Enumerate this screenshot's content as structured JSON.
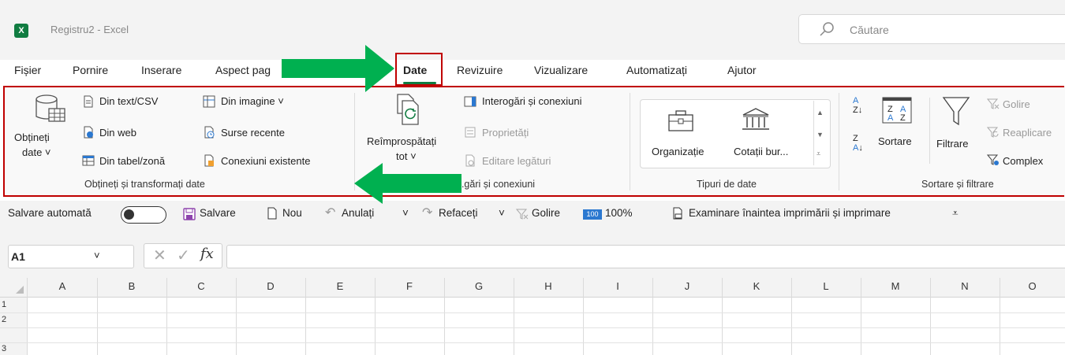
{
  "app": {
    "logo": "X",
    "title": "Registru2 - Excel"
  },
  "search": {
    "placeholder": "Căutare",
    "icon": "search-icon"
  },
  "menu": {
    "items": [
      "Fișier",
      "Pornire",
      "Inserare",
      "Aspect pag",
      "Date",
      "Revizuire",
      "Vizualizare",
      "Automatizați",
      "Ajutor"
    ],
    "active": "Date"
  },
  "ribbon": {
    "get_data": {
      "big_button": [
        "Obțineți",
        "date ˅"
      ],
      "from_text": "Din text/CSV",
      "from_web": "Din web",
      "from_table": "Din tabel/zonă",
      "from_image": "Din imagine ˅",
      "recent_sources": "Surse recente",
      "existing_connections": "Conexiuni existente",
      "group_label": "Obțineți și transformați date"
    },
    "queries": {
      "refresh_button": [
        "Reîmprospătați",
        "tot ˅"
      ],
      "queries_connections": "Interogări și conexiuni",
      "properties": "Proprietăți",
      "edit_links": "Editare legături",
      "group_label": "...gări și conexiuni"
    },
    "data_types": {
      "organization": "Organizație",
      "stocks": "Cotații bur...",
      "group_label": "Tipuri de date"
    },
    "sort_filter": {
      "sort": "Sortare",
      "filter": "Filtrare",
      "clear": "Golire",
      "reapply": "Reaplicare",
      "advanced": "Complex",
      "group_label": "Sortare și filtrare"
    }
  },
  "qat": {
    "autosave": "Salvare automată",
    "save": "Salvare",
    "new": "Nou",
    "undo": "Anulați",
    "redo": "Refaceți",
    "clear": "Golire",
    "zoom": "100%",
    "zoom_badge": "100",
    "print_preview": "Examinare înaintea imprimării și imprimare"
  },
  "formula_bar": {
    "name_box": "A1",
    "fx": "fx",
    "value": ""
  },
  "grid": {
    "columns": [
      "A",
      "B",
      "C",
      "D",
      "E",
      "F",
      "G",
      "H",
      "I",
      "J",
      "K",
      "L",
      "M",
      "N",
      "O"
    ],
    "rows": [
      "1",
      "2",
      "3"
    ]
  },
  "colors": {
    "excel_green": "#107c41",
    "highlight_red": "#c00000",
    "arrow_green": "#00b050"
  }
}
